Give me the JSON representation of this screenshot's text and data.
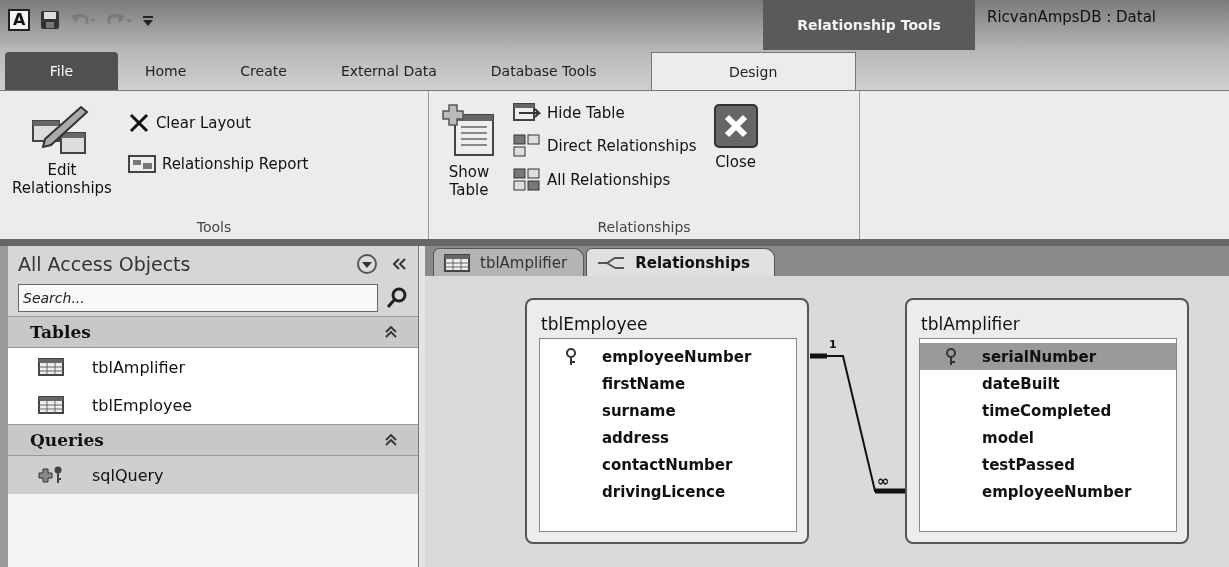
{
  "app_badge": "A",
  "quick_access": [
    {
      "kind": "save",
      "disabled": false
    },
    {
      "kind": "undo",
      "disabled": true
    },
    {
      "kind": "redo",
      "disabled": true
    },
    {
      "kind": "customize",
      "disabled": false
    }
  ],
  "contextual_group": {
    "label": "Relationship Tools"
  },
  "window_title": "RicvanAmpsDB : Datal",
  "ribbon_tabs": [
    {
      "label": "File",
      "kind": "backstage",
      "selected": false
    },
    {
      "label": "Home",
      "kind": "tab",
      "selected": false
    },
    {
      "label": "Create",
      "kind": "tab",
      "selected": false
    },
    {
      "label": "External Data",
      "kind": "tab",
      "selected": false
    },
    {
      "label": "Database Tools",
      "kind": "tab",
      "selected": false
    },
    {
      "label": "Design",
      "kind": "contextual",
      "selected": true
    }
  ],
  "ribbon_groups": [
    {
      "label": "Tools",
      "commands": [
        {
          "label": "Edit Relationships",
          "kind": "large"
        },
        {
          "label": "Clear Layout",
          "kind": "small"
        },
        {
          "label": "Relationship Report",
          "kind": "small"
        }
      ]
    },
    {
      "label": "Relationships",
      "commands": [
        {
          "label": "Show Table",
          "kind": "large"
        },
        {
          "label": "Hide Table",
          "kind": "small"
        },
        {
          "label": "Direct Relationships",
          "kind": "small"
        },
        {
          "label": "All Relationships",
          "kind": "small"
        },
        {
          "label": "Close",
          "kind": "large"
        }
      ]
    }
  ],
  "nav_pane": {
    "title": "All Access Objects",
    "search": {
      "placeholder": "Search..."
    },
    "groups": [
      {
        "label": "Tables",
        "expanded": true,
        "items": [
          {
            "label": "tblAmplifier",
            "kind": "table",
            "selected": false
          },
          {
            "label": "tblEmployee",
            "kind": "table",
            "selected": false
          }
        ]
      },
      {
        "label": "Queries",
        "expanded": true,
        "items": [
          {
            "label": "sqlQuery",
            "kind": "query",
            "selected": true
          }
        ]
      }
    ]
  },
  "document_tabs": [
    {
      "label": "tblAmplifier",
      "kind": "table",
      "selected": false
    },
    {
      "label": "Relationships",
      "kind": "relationships",
      "selected": true
    }
  ],
  "canvas": {
    "tables": [
      {
        "name": "tblEmployee",
        "fields": [
          {
            "name": "employeeNumber",
            "primary_key": true,
            "selected": false
          },
          {
            "name": "firstName",
            "primary_key": false,
            "selected": false
          },
          {
            "name": "surname",
            "primary_key": false,
            "selected": false
          },
          {
            "name": "address",
            "primary_key": false,
            "selected": false
          },
          {
            "name": "contactNumber",
            "primary_key": false,
            "selected": false
          },
          {
            "name": "drivingLicence",
            "primary_key": false,
            "selected": false
          }
        ]
      },
      {
        "name": "tblAmplifier",
        "fields": [
          {
            "name": "serialNumber",
            "primary_key": true,
            "selected": true
          },
          {
            "name": "dateBuilt",
            "primary_key": false,
            "selected": false
          },
          {
            "name": "timeCompleted",
            "primary_key": false,
            "selected": false
          },
          {
            "name": "model",
            "primary_key": false,
            "selected": false
          },
          {
            "name": "testPassed",
            "primary_key": false,
            "selected": false
          },
          {
            "name": "employeeNumber",
            "primary_key": false,
            "selected": false
          }
        ]
      }
    ],
    "relationship": {
      "one_label": "1",
      "many_label": "∞"
    }
  }
}
